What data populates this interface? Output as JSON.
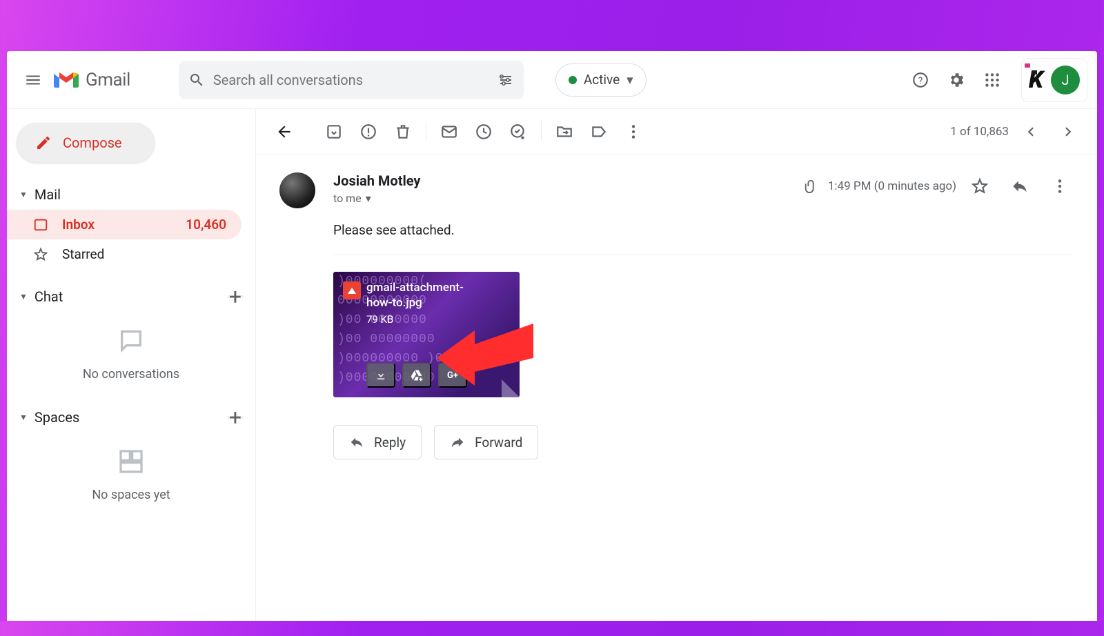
{
  "header": {
    "product": "Gmail",
    "search_placeholder": "Search all conversations",
    "status": "Active",
    "avatar_initial": "J"
  },
  "sidebar": {
    "compose": "Compose",
    "sections": {
      "mail": "Mail",
      "chat": "Chat",
      "spaces": "Spaces"
    },
    "inbox": {
      "label": "Inbox",
      "count": "10,460"
    },
    "starred": "Starred",
    "chat_empty": "No conversations",
    "spaces_empty": "No spaces yet"
  },
  "toolbar": {
    "position": "1 of 10,863"
  },
  "message": {
    "sender": "Josiah Motley",
    "recipient": "to me",
    "time": "1:49 PM (0 minutes ago)",
    "body": "Please see attached.",
    "attachment": {
      "name": "gmail-attachment-how-to.jpg",
      "size": "79 KB"
    },
    "reply": "Reply",
    "forward": "Forward"
  }
}
